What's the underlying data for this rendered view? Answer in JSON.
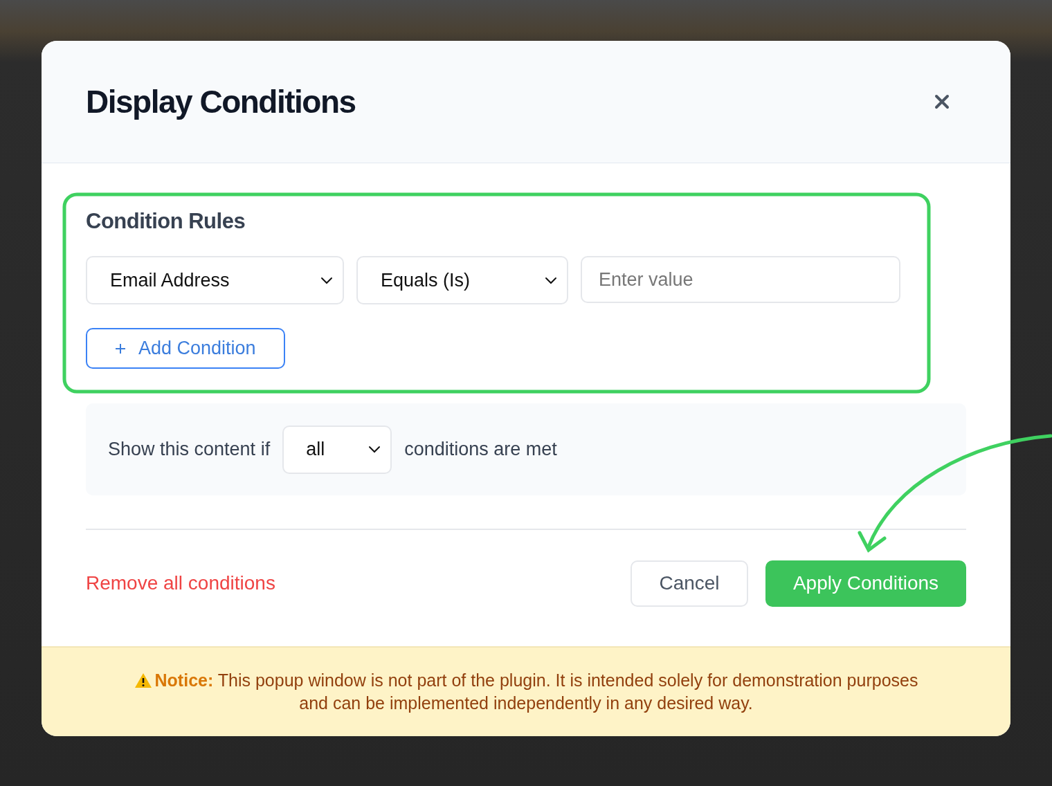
{
  "dialog": {
    "title": "Display Conditions"
  },
  "rules": {
    "heading": "Condition Rules",
    "conditions": [
      {
        "field": "Email Address",
        "operator": "Equals (Is)",
        "placeholder": "Enter value"
      }
    ],
    "add_button": "Add Condition"
  },
  "match": {
    "prefix": "Show this content if",
    "mode": "all",
    "suffix": "conditions are met"
  },
  "footer": {
    "remove_link": "Remove all conditions",
    "buttons": [
      {
        "label": "Cancel",
        "kind": "secondary"
      },
      {
        "label": "Apply Conditions",
        "kind": "primary"
      }
    ]
  },
  "notice": "**Notice:** This popup window is not part of the plugin. It is intended solely for demonstration purposes and can be implemented independently in any desired way."
}
